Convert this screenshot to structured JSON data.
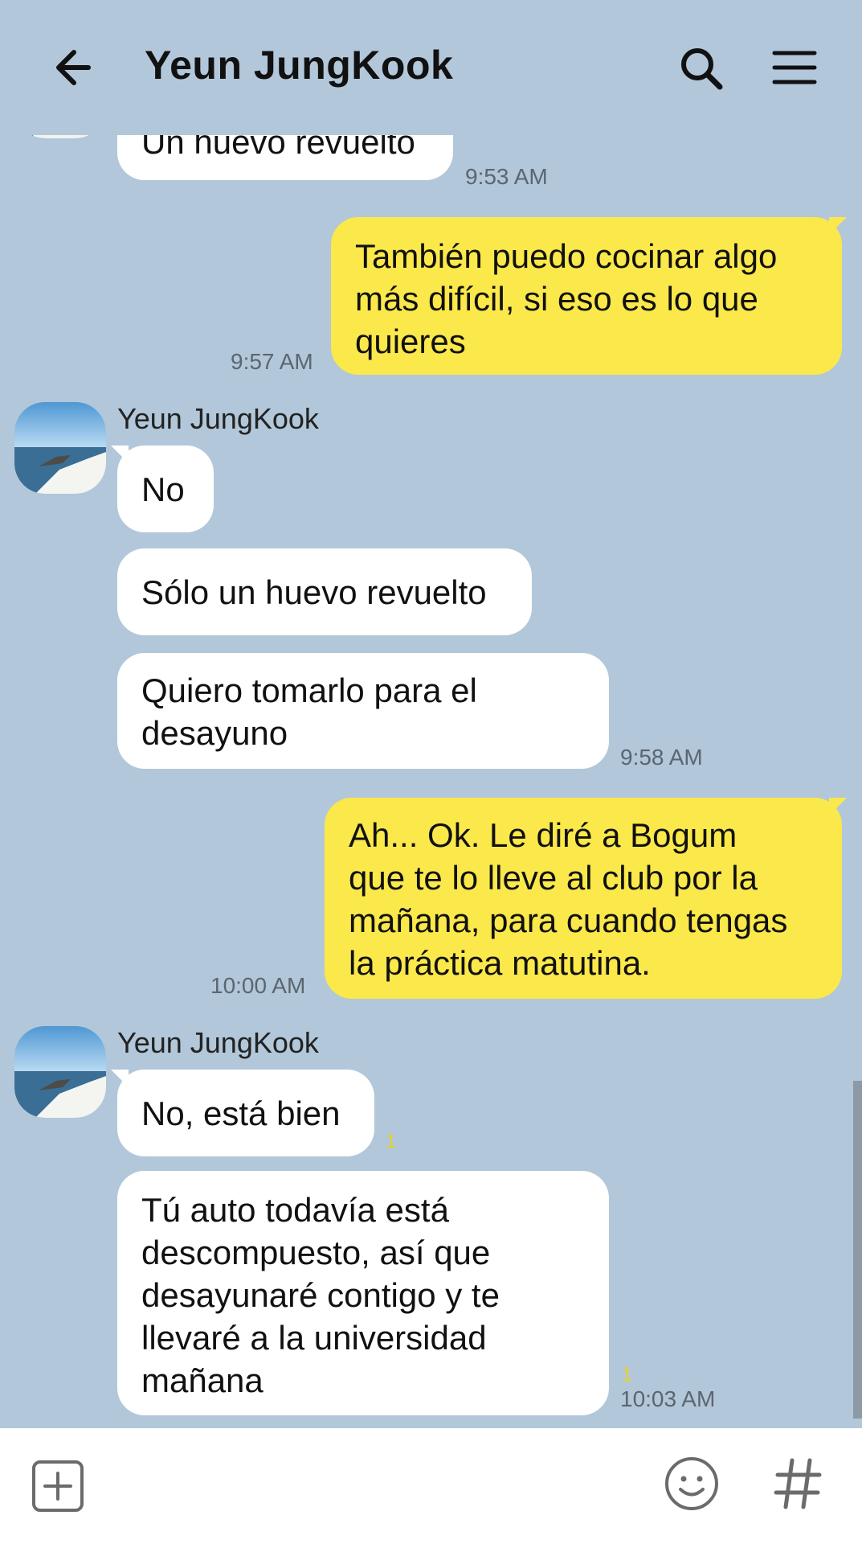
{
  "header": {
    "title": "Yeun JungKook",
    "back_icon": "arrow-left-icon",
    "search_icon": "search-icon",
    "menu_icon": "hamburger-menu-icon"
  },
  "colors": {
    "background": "#b2c7da",
    "incoming_bubble": "#ffffff",
    "outgoing_bubble": "#fbe84a",
    "unread": "#e8d321"
  },
  "messages": [
    {
      "direction": "in",
      "text": "Un huevo revuelto",
      "time": "9:53 AM"
    },
    {
      "direction": "out",
      "text": "También puedo cocinar algo\nmás difícil, si eso es lo que\nquieres",
      "time": "9:57 AM"
    },
    {
      "direction": "in",
      "sender": "Yeun JungKook",
      "text": "No"
    },
    {
      "direction": "in",
      "text": "Sólo un huevo revuelto"
    },
    {
      "direction": "in",
      "text": "Quiero tomarlo para el\ndesayuno",
      "time": "9:58 AM"
    },
    {
      "direction": "out",
      "text": "Ah... Ok. Le diré a Bogum\nque te lo lleve al club por la\nmañana, para cuando tengas\nla práctica matutina.",
      "time": "10:00 AM"
    },
    {
      "direction": "in",
      "sender": "Yeun JungKook",
      "text": "No, está bien",
      "unread": "1"
    },
    {
      "direction": "in",
      "text": "Tú auto todavía está\ndescompuesto, así que\ndesayunaré contigo y te\nllevaré a la universidad\nmañana",
      "unread": "1",
      "time": "10:03 AM"
    }
  ],
  "input_bar": {
    "add_icon": "plus-box-icon",
    "emoji_icon": "emoji-icon",
    "hash_icon": "hashtag-icon",
    "hash_label": "#"
  }
}
